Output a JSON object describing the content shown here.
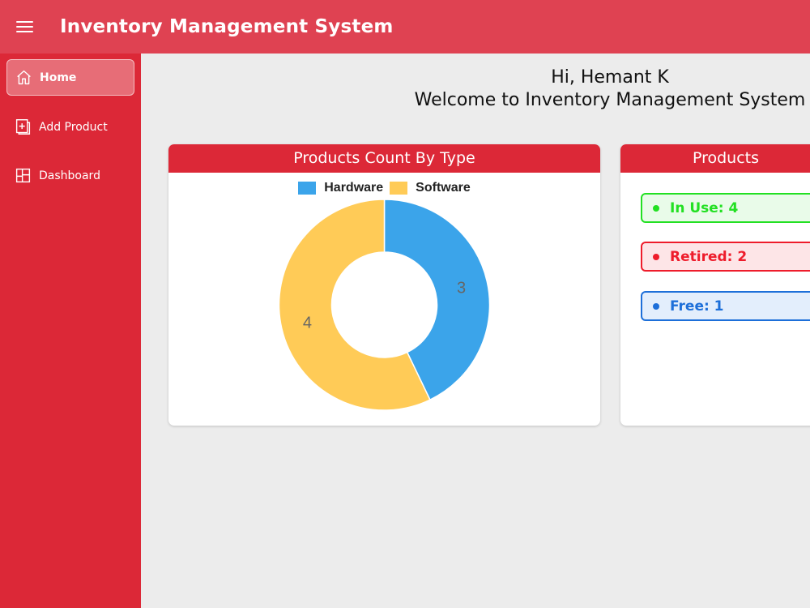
{
  "header": {
    "title": "Inventory Management System"
  },
  "sidebar": {
    "items": [
      {
        "label": "Home"
      },
      {
        "label": "Add Product"
      },
      {
        "label": "Dashboard"
      }
    ]
  },
  "greeting": {
    "line1": "Hi, Hemant K",
    "line2": "Welcome to Inventory Management System"
  },
  "type_card": {
    "title": "Products Count By Type"
  },
  "status_card": {
    "title": "Products",
    "items": [
      {
        "label": "In Use: 4",
        "color": "#22e022",
        "bg": "#e9fbe9"
      },
      {
        "label": "Retired: 2",
        "color": "#ee1c2b",
        "bg": "#fde5e7"
      },
      {
        "label": "Free: 1",
        "color": "#1d6fd9",
        "bg": "#e3eefc"
      }
    ]
  },
  "colors": {
    "accent": "#dc2837",
    "topbar": "#df4252",
    "hardware": "#3ba4ea",
    "software": "#ffcb57"
  },
  "chart_data": {
    "type": "pie",
    "variant": "doughnut",
    "title": "Products Count By Type",
    "categories": [
      "Hardware",
      "Software"
    ],
    "values": [
      3,
      4
    ],
    "colors": [
      "#3ba4ea",
      "#ffcb57"
    ],
    "legend": "top"
  }
}
